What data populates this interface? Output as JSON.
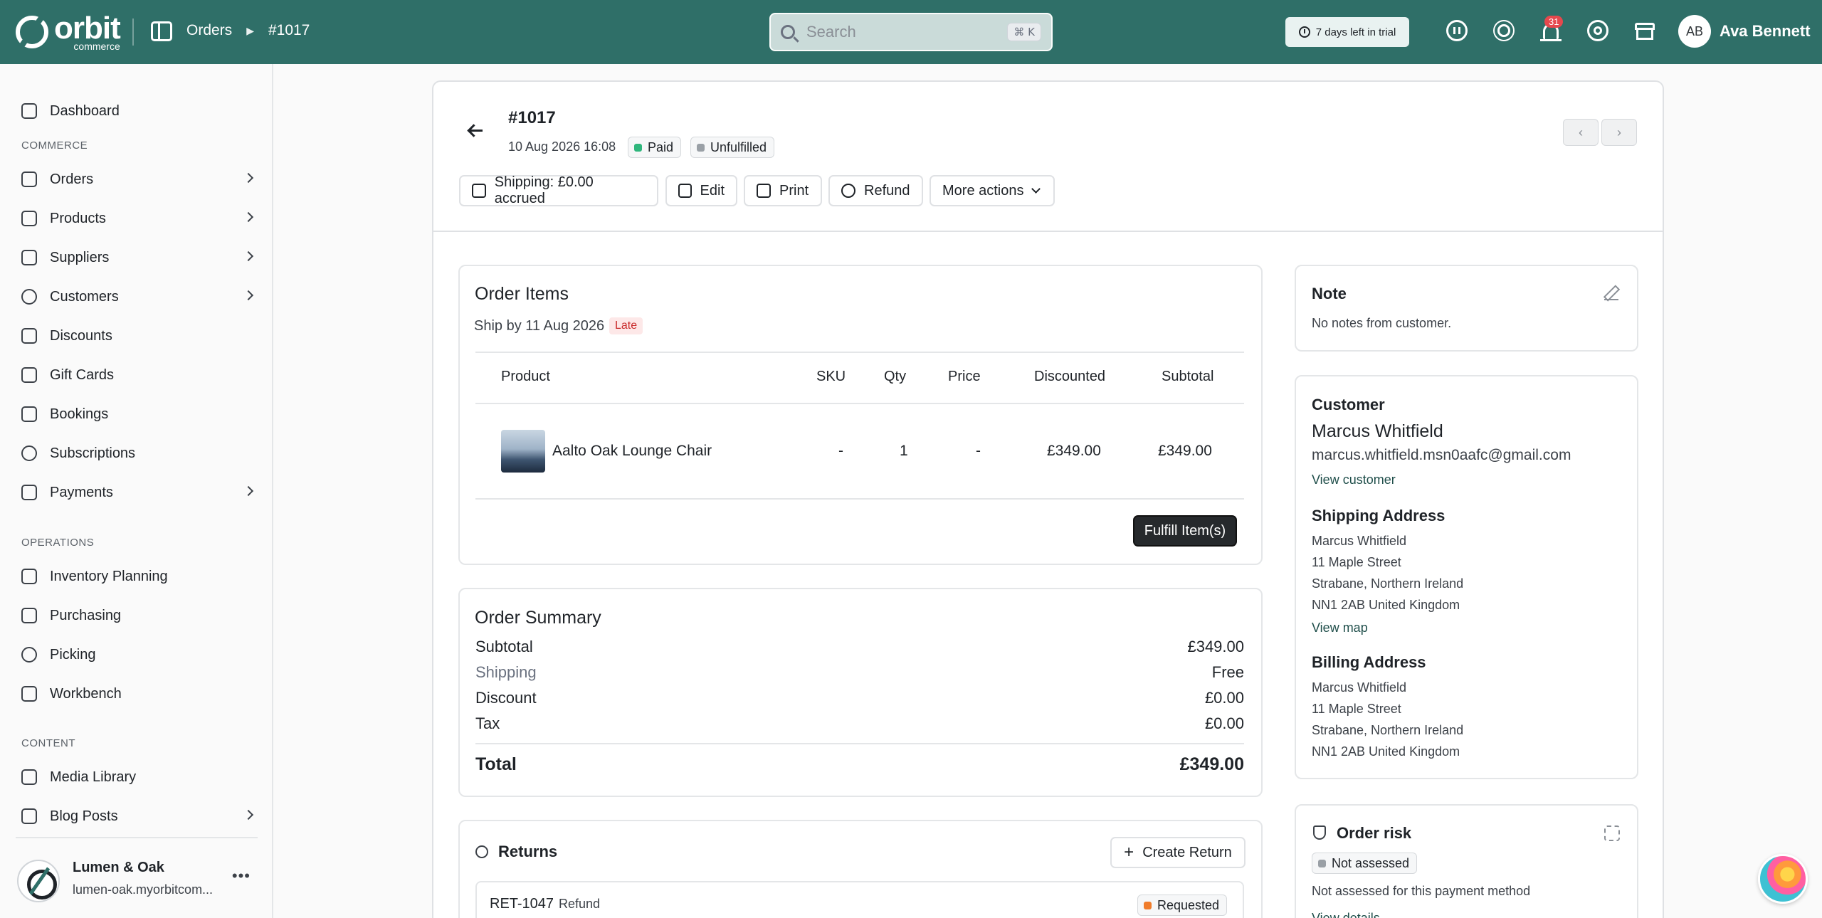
{
  "brand": {
    "name": "orbit",
    "sub": "commerce"
  },
  "breadcrumb": [
    "Orders",
    "#1017"
  ],
  "search": {
    "placeholder": "Search",
    "shortcut": "⌘ K"
  },
  "trial": "7 days left in trial",
  "notifications": {
    "count": "31"
  },
  "user": {
    "initials": "AB",
    "name": "Ava Bennett"
  },
  "sidebar": {
    "dashboard": "Dashboard",
    "sections": {
      "commerce": "COMMERCE",
      "operations": "OPERATIONS",
      "content": "CONTENT"
    },
    "commerce": [
      "Orders",
      "Products",
      "Suppliers",
      "Customers",
      "Discounts",
      "Gift Cards",
      "Bookings",
      "Subscriptions",
      "Payments"
    ],
    "operations": [
      "Inventory Planning",
      "Purchasing",
      "Picking",
      "Workbench"
    ],
    "content": [
      "Media Library",
      "Blog Posts"
    ],
    "store": {
      "name": "Lumen & Oak",
      "url": "lumen-oak.myorbitcom..."
    }
  },
  "order": {
    "title": "#1017",
    "date": "10 Aug 2026 16:08",
    "payment_status": "Paid",
    "fulfillment_status": "Unfulfilled",
    "colors": {
      "paid": "#2fb67c",
      "unfulfilled": "#9aa0a6",
      "requested": "#f07c2b"
    }
  },
  "actions": {
    "shipping": "Shipping: £0.00 accrued",
    "edit": "Edit",
    "print": "Print",
    "refund": "Refund",
    "more": "More actions"
  },
  "items": {
    "title": "Order Items",
    "ship_by": "Ship by 11 Aug 2026",
    "late": "Late",
    "headers": [
      "Product",
      "SKU",
      "Qty",
      "Price",
      "Discounted",
      "Subtotal"
    ],
    "rows": [
      {
        "product": "Aalto Oak Lounge Chair",
        "sku": "-",
        "qty": "1",
        "price": "-",
        "discounted": "£349.00",
        "subtotal": "£349.00"
      }
    ],
    "fulfill": "Fulfill Item(s)"
  },
  "summary": {
    "title": "Order Summary",
    "rows": [
      {
        "label": "Subtotal",
        "value": "£349.00"
      },
      {
        "label": "Shipping",
        "value": "Free"
      },
      {
        "label": "Discount",
        "value": "£0.00"
      },
      {
        "label": "Tax",
        "value": "£0.00"
      }
    ],
    "total_label": "Total",
    "total_value": "£349.00"
  },
  "returns": {
    "title": "Returns",
    "create": "Create Return",
    "row": {
      "id": "RET-1047",
      "type": "Refund",
      "status": "Requested"
    }
  },
  "note": {
    "title": "Note",
    "text": "No notes from customer."
  },
  "customer": {
    "title": "Customer",
    "name": "Marcus Whitfield",
    "email": "marcus.whitfield.msn0aafc@gmail.com",
    "view": "View customer",
    "shipping_title": "Shipping Address",
    "shipping": [
      "Marcus Whitfield",
      "11 Maple Street",
      "Strabane, Northern Ireland",
      "NN1 2AB United Kingdom"
    ],
    "view_map": "View map",
    "billing_title": "Billing Address",
    "billing": [
      "Marcus Whitfield",
      "11 Maple Street",
      "Strabane, Northern Ireland",
      "NN1 2AB United Kingdom"
    ]
  },
  "risk": {
    "title": "Order risk",
    "status": "Not assessed",
    "text": "Not assessed for this payment method",
    "link": "View details"
  }
}
